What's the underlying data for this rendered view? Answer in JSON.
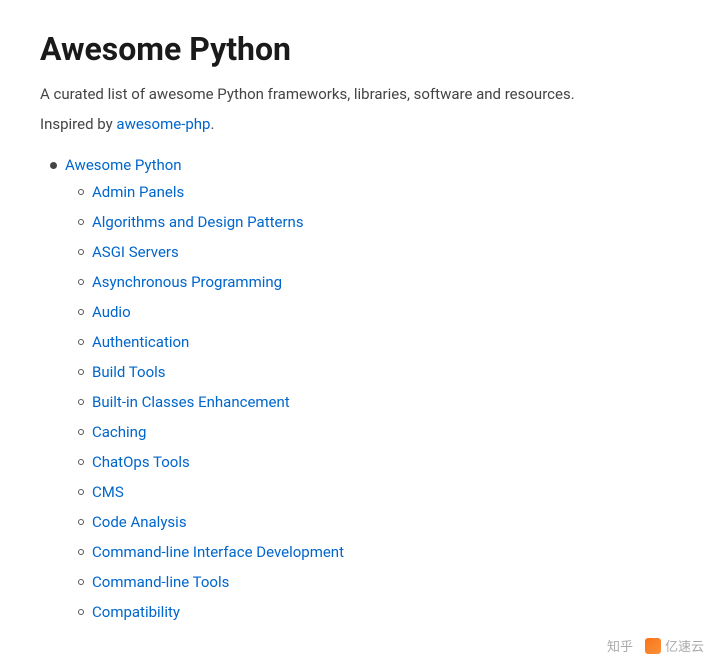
{
  "page": {
    "title": "Awesome Python",
    "description": "A curated list of awesome Python frameworks, libraries, software and resources.",
    "inspired_text": "Inspired by ",
    "inspired_link_text": "awesome-php",
    "inspired_link_href": "#",
    "inspired_period": "."
  },
  "top_level_item": {
    "label": "Awesome Python",
    "href": "#"
  },
  "sub_items": [
    {
      "label": "Admin Panels",
      "href": "#"
    },
    {
      "label": "Algorithms and Design Patterns",
      "href": "#"
    },
    {
      "label": "ASGI Servers",
      "href": "#"
    },
    {
      "label": "Asynchronous Programming",
      "href": "#"
    },
    {
      "label": "Audio",
      "href": "#"
    },
    {
      "label": "Authentication",
      "href": "#"
    },
    {
      "label": "Build Tools",
      "href": "#"
    },
    {
      "label": "Built-in Classes Enhancement",
      "href": "#"
    },
    {
      "label": "Caching",
      "href": "#"
    },
    {
      "label": "ChatOps Tools",
      "href": "#"
    },
    {
      "label": "CMS",
      "href": "#"
    },
    {
      "label": "Code Analysis",
      "href": "#"
    },
    {
      "label": "Command-line Interface Development",
      "href": "#"
    },
    {
      "label": "Command-line Tools",
      "href": "#"
    },
    {
      "label": "Compatibility",
      "href": "#"
    }
  ],
  "watermarks": {
    "zhihu": "知乎",
    "yisuyun": "亿速云"
  }
}
